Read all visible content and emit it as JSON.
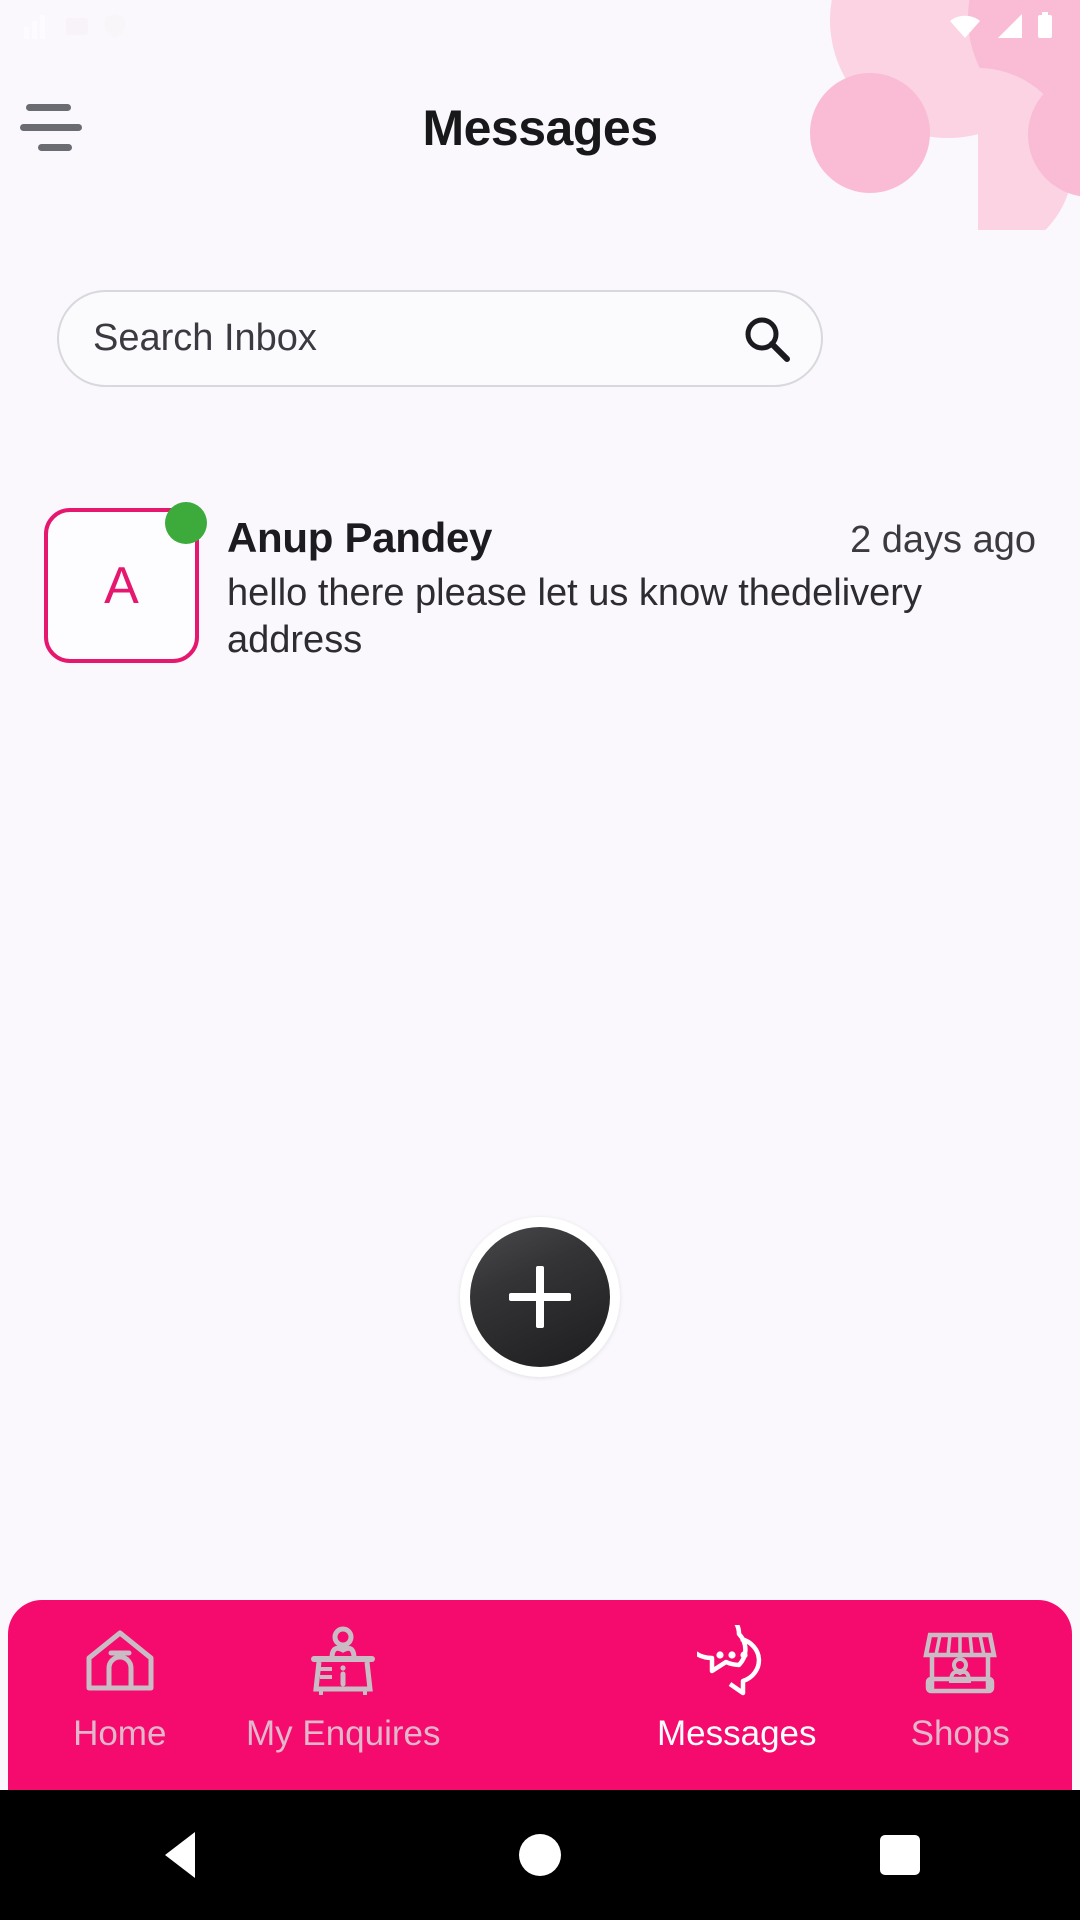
{
  "theme": {
    "background": "#faf8fc",
    "accent_pink": "#f50a6e",
    "avatar_pink": "#e5176e",
    "online_green": "#3cab3c",
    "nav_inactive": "#e3b7cb",
    "nav_active": "#ffffff",
    "deco_pink_light": "#fbd3e2",
    "deco_pink": "#f9bcd4"
  },
  "statusbar": {
    "left_icons": [
      "signal-bars-icon",
      "screenshot-icon",
      "shield-icon"
    ],
    "right_icons": [
      "wifi-icon",
      "mobile-signal-icon",
      "battery-icon"
    ]
  },
  "header": {
    "menu_icon": "hamburger-menu-icon",
    "title": "Messages"
  },
  "search": {
    "placeholder": "Search Inbox",
    "value": "",
    "icon": "search-icon"
  },
  "messages": [
    {
      "avatar_initial": "A",
      "online": true,
      "name": "Anup Pandey",
      "time": "2 days ago",
      "preview": "hello there please let us know thedelivery address"
    }
  ],
  "fab": {
    "icon": "plus-icon",
    "label": "+"
  },
  "bottom_nav": {
    "items": [
      {
        "label": "Home",
        "icon": "home-icon",
        "active": false
      },
      {
        "label": "My Enquires",
        "icon": "info-desk-icon",
        "active": false
      },
      {
        "label": "Messages",
        "icon": "chat-bubbles-icon",
        "active": true
      },
      {
        "label": "Shops",
        "icon": "storefront-icon",
        "active": false
      }
    ]
  },
  "system_nav": {
    "back": "back-triangle-icon",
    "home": "home-circle-icon",
    "recents": "recents-square-icon"
  }
}
